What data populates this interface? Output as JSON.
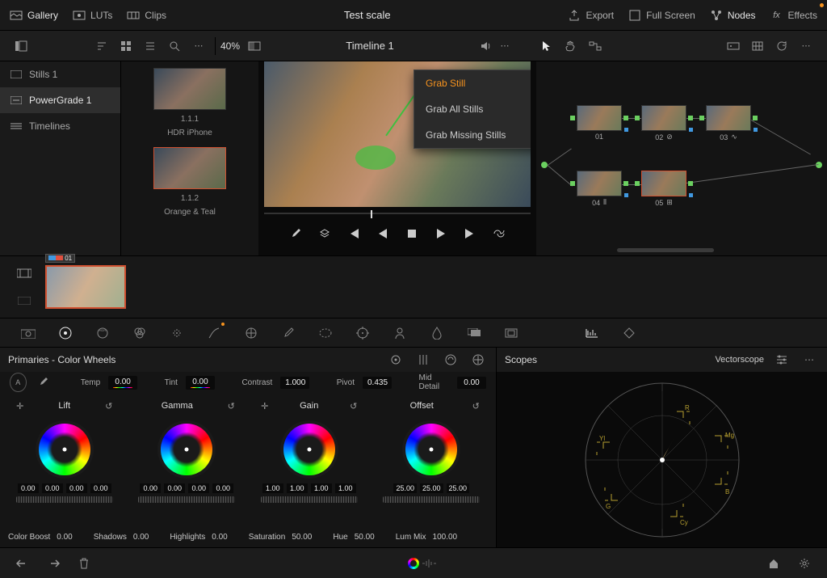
{
  "topbar": {
    "gallery": "Gallery",
    "luts": "LUTs",
    "clips": "Clips",
    "title": "Test scale",
    "export": "Export",
    "fullscreen": "Full Screen",
    "nodes": "Nodes",
    "effects": "Effects"
  },
  "toolbar": {
    "zoom": "40%",
    "timeline": "Timeline 1"
  },
  "leftpanel": {
    "items": [
      {
        "label": "Stills 1"
      },
      {
        "label": "PowerGrade 1"
      },
      {
        "label": "Timelines"
      }
    ]
  },
  "stills": [
    {
      "id": "1.1.1",
      "name": "HDR iPhone"
    },
    {
      "id": "1.1.2",
      "name": "Orange & Teal"
    }
  ],
  "context_menu": [
    {
      "label": "Grab Still",
      "arrow": false,
      "hl": true
    },
    {
      "label": "Grab All Stills",
      "arrow": true,
      "hl": false
    },
    {
      "label": "Grab Missing Stills",
      "arrow": true,
      "hl": false
    }
  ],
  "nodes": [
    {
      "num": "01"
    },
    {
      "num": "02"
    },
    {
      "num": "03"
    },
    {
      "num": "04"
    },
    {
      "num": "05"
    }
  ],
  "clip": {
    "badge": "01"
  },
  "primaries": {
    "title": "Primaries - Color Wheels",
    "top": {
      "temp_lbl": "Temp",
      "temp": "0.00",
      "tint_lbl": "Tint",
      "tint": "0.00",
      "contrast_lbl": "Contrast",
      "contrast": "1.000",
      "pivot_lbl": "Pivot",
      "pivot": "0.435",
      "mid_lbl": "Mid Detail",
      "mid": "0.00"
    },
    "wheels": [
      {
        "name": "Lift",
        "v": [
          "0.00",
          "0.00",
          "0.00",
          "0.00"
        ]
      },
      {
        "name": "Gamma",
        "v": [
          "0.00",
          "0.00",
          "0.00",
          "0.00"
        ]
      },
      {
        "name": "Gain",
        "v": [
          "1.00",
          "1.00",
          "1.00",
          "1.00"
        ]
      },
      {
        "name": "Offset",
        "v": [
          "25.00",
          "25.00",
          "25.00"
        ]
      }
    ],
    "bottom": {
      "colorboost_lbl": "Color Boost",
      "colorboost": "0.00",
      "shadows_lbl": "Shadows",
      "shadows": "0.00",
      "highlights_lbl": "Highlights",
      "highlights": "0.00",
      "saturation_lbl": "Saturation",
      "saturation": "50.00",
      "hue_lbl": "Hue",
      "hue": "50.00",
      "lummix_lbl": "Lum Mix",
      "lummix": "100.00"
    }
  },
  "scopes": {
    "title": "Scopes",
    "type": "Vectorscope"
  }
}
